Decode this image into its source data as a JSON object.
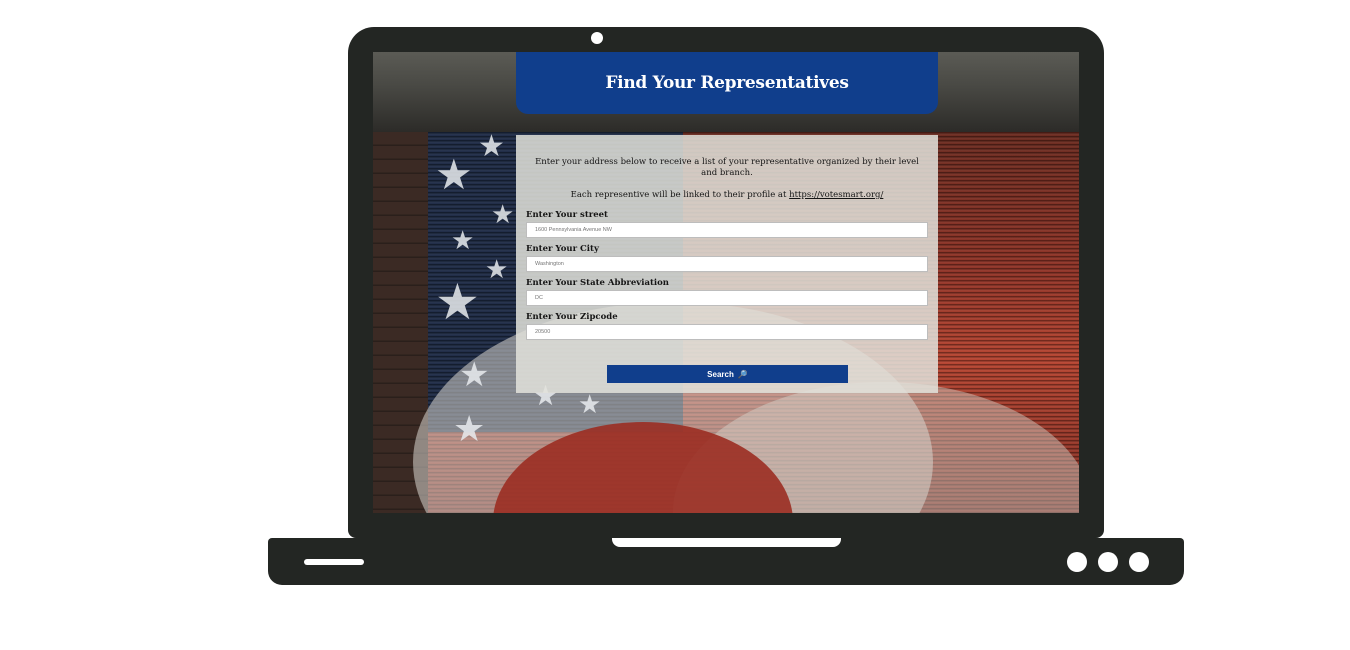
{
  "header": {
    "title": "Find Your Representatives"
  },
  "intro": {
    "line1": "Enter your address below to receive a list of your representative organized by their level and branch.",
    "line2_prefix": "Each representive will be linked to their profile at ",
    "line2_link": "https://votesmart.org/"
  },
  "form": {
    "street": {
      "label": "Enter Your street",
      "placeholder": "1600 Pennsylvania Avenue NW"
    },
    "city": {
      "label": "Enter Your City",
      "placeholder": "Washington"
    },
    "state": {
      "label": "Enter Your State Abbreviation",
      "placeholder": "DC"
    },
    "zip": {
      "label": "Enter Your Zipcode",
      "placeholder": "20500"
    },
    "search_label": "Search",
    "search_icon": "🔎"
  },
  "colors": {
    "brand_blue": "#103e8c",
    "laptop_frame": "#232623"
  }
}
